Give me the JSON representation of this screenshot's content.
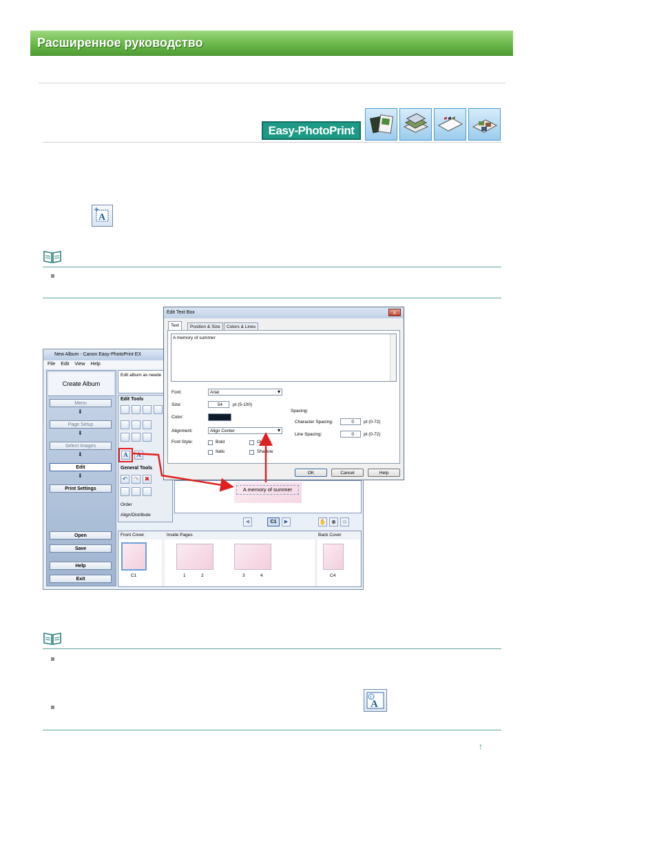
{
  "header": {
    "title": "Расширенное руководство"
  },
  "logo": {
    "text": "Easy-PhotoPrint EX",
    "color": "#1d9a85"
  },
  "mode_icons": [
    "album-icon",
    "photo-print-icon",
    "calendar-icon",
    "sticker-icon"
  ],
  "app_window": {
    "title": "New Album - Canon Easy-PhotoPrint EX",
    "menu": [
      "File",
      "Edit",
      "View",
      "Help"
    ],
    "left_panel": {
      "heading": "Create Album",
      "menu_button": "Menu",
      "steps": [
        {
          "label": "Page Setup",
          "num": "1"
        },
        {
          "label": "Select Images",
          "num": "2"
        },
        {
          "label": "Edit",
          "num": "3"
        },
        {
          "label": "Print Settings",
          "num": "4"
        }
      ],
      "buttons": [
        "Open",
        "Save",
        "Help",
        "Exit"
      ]
    },
    "instruction_text": "Edit album as neede",
    "edit_tools_label": "Edit Tools",
    "general_tools_label": "General Tools",
    "order_label": "Order",
    "align_label": "Align/Distribute",
    "page_indicator": "C1",
    "canvas_text": "A memory of summer",
    "thumbnails": {
      "front_cover": "Front Cover",
      "inside_pages": "Inside Pages",
      "back_cover": "Back Cover",
      "front_page_label": "C1",
      "inside_labels": [
        "1",
        "2",
        "3",
        "4"
      ],
      "back_page_label": "C4"
    }
  },
  "dialog": {
    "title": "Edit Text Box",
    "close": "x",
    "tabs": [
      "Text",
      "Position & Size",
      "Colors & Lines"
    ],
    "text_value": "A memory of summer",
    "font_label": "Font:",
    "font_value": "Arial",
    "size_label": "Size:",
    "size_value": "54",
    "size_range": "pt (5-100)",
    "color_label": "Color:",
    "color_value": "#0d1b2a",
    "alignment_label": "Alignment:",
    "alignment_value": "Align Center",
    "font_style_label": "Font Style:",
    "styles": [
      "Bold",
      "Outline",
      "Italic",
      "Shadow"
    ],
    "spacing_label": "Spacing:",
    "char_spacing_label": "Character Spacing:",
    "char_spacing_value": "0",
    "line_spacing_label": "Line Spacing:",
    "line_spacing_value": "0",
    "spacing_range": "pt (0-72)",
    "buttons": [
      "OK",
      "Cancel",
      "Help"
    ]
  },
  "colors": {
    "highlight": "#e02020",
    "banner": "#6ab84a",
    "rule": "#5aa3a3"
  }
}
